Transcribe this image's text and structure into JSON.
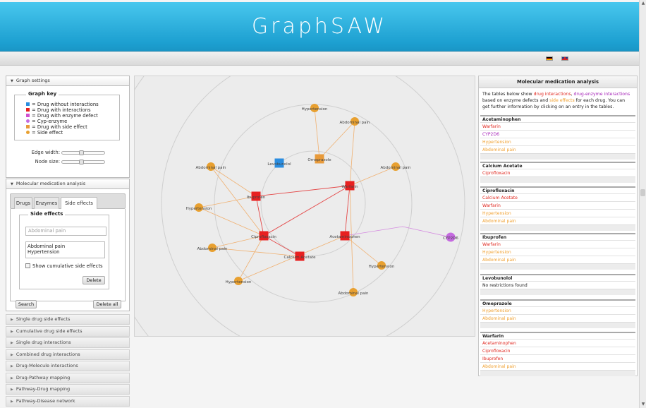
{
  "app": {
    "title": "GraphSAW",
    "languages": [
      {
        "name": "de-flag-icon"
      },
      {
        "name": "gb-flag-icon"
      }
    ]
  },
  "graph_settings": {
    "header": "Graph settings",
    "key_title": "Graph key",
    "key_items": [
      {
        "label": "= Drug without interactions",
        "color": "#2a8de0",
        "shape": "square"
      },
      {
        "label": "= Drug with interactions",
        "color": "#e82020",
        "shape": "square"
      },
      {
        "label": "= Drug with enzyme defect",
        "color": "#d050d0",
        "shape": "square"
      },
      {
        "label": "= Cyp-enzyme",
        "color": "#c56ae0",
        "shape": "circle"
      },
      {
        "label": "= Drug with side effect",
        "color": "#e89a3a",
        "shape": "square"
      },
      {
        "label": "= Side effect",
        "color": "#e8a030",
        "shape": "circle"
      }
    ],
    "edge_width_label": "Edge width:",
    "node_size_label": "Node size:",
    "edge_width_value": 0.45,
    "node_size_value": 0.45
  },
  "mma_panel": {
    "header": "Molecular medication analysis",
    "tabs": [
      {
        "label": "Drugs",
        "active": false
      },
      {
        "label": "Enzymes",
        "active": false
      },
      {
        "label": "Side effects",
        "active": true
      }
    ],
    "side_effects_title": "Side effects",
    "input_placeholder": "Abdominal pain",
    "list_items": [
      "Abdominal pain",
      "Hypertension"
    ],
    "cumulative_label": "Show cumulative side effects",
    "delete_label": "Delete",
    "search_label": "Search",
    "delete_all_label": "Delete all"
  },
  "accordion": [
    "Single drug side effects",
    "Cumulative drug side effects",
    "Single drug interactions",
    "Combined drug interactions",
    "Drug-Molecule interactions",
    "Drug-Pathway mapping",
    "Pathway-Drug mapping",
    "Pathway-Disease network"
  ],
  "graph": {
    "colors": {
      "interaction": "#e82020",
      "no_interaction": "#2a8de0",
      "side_effect_drug": "#e89a3a",
      "side_effect": "#e8a030",
      "enzyme": "#c56ae0",
      "edge_interaction": "#e44848",
      "edge_side_effect": "#f0b070",
      "edge_enzyme": "#d48ae0"
    },
    "nodes": {
      "drugs": [
        {
          "label": "Levobunolol",
          "color": "no_interaction"
        },
        {
          "label": "Omeprazole",
          "color": "side_effect_drug"
        },
        {
          "label": "Ibuprofen",
          "color": "interaction"
        },
        {
          "label": "Warfarin",
          "color": "interaction"
        },
        {
          "label": "Ciprofloxacin",
          "color": "interaction"
        },
        {
          "label": "Acetaminophen",
          "color": "interaction"
        },
        {
          "label": "Calcium Acetate",
          "color": "interaction"
        }
      ],
      "side_effects": [
        {
          "label": "Hypertension"
        },
        {
          "label": "Abdominal pain"
        },
        {
          "label": "Abdominal pain"
        },
        {
          "label": "Abdominal pain"
        },
        {
          "label": "Hypertension"
        },
        {
          "label": "Abdominal pain"
        },
        {
          "label": "Hypertension"
        },
        {
          "label": "Hypertension"
        },
        {
          "label": "Abdominal pain"
        }
      ],
      "enzymes": [
        {
          "label": "CYP2D6"
        }
      ]
    }
  },
  "results": {
    "title": "Molecular medication analysis",
    "intro_parts": [
      {
        "text": "The tables below show ",
        "cls": "c-none"
      },
      {
        "text": "drug interactions",
        "cls": "c-int"
      },
      {
        "text": ", ",
        "cls": "c-none"
      },
      {
        "text": "drug-enzyme interactions",
        "cls": "c-enz"
      },
      {
        "text": " based on enzyme defects and ",
        "cls": "c-none"
      },
      {
        "text": "side effects",
        "cls": "c-se"
      },
      {
        "text": " for each drug. You can get further information by clicking on an entry in the tables.",
        "cls": "c-none"
      }
    ],
    "drugs": [
      {
        "name": "Acetaminophen",
        "rows": [
          {
            "text": "Warfarin",
            "cls": "c-int"
          },
          {
            "text": "CYP2D6",
            "cls": "c-enz"
          },
          {
            "text": "Hypertension",
            "cls": "c-se"
          },
          {
            "text": "Abdominal pain",
            "cls": "c-se"
          }
        ]
      },
      {
        "name": "Calcium Acetate",
        "rows": [
          {
            "text": "Ciprofloxacin",
            "cls": "c-int"
          }
        ]
      },
      {
        "name": "Ciprofloxacin",
        "rows": [
          {
            "text": "Calcium Acetate",
            "cls": "c-int"
          },
          {
            "text": "Warfarin",
            "cls": "c-int"
          },
          {
            "text": "Hypertension",
            "cls": "c-se"
          },
          {
            "text": "Abdominal pain",
            "cls": "c-se"
          }
        ]
      },
      {
        "name": "Ibuprofen",
        "rows": [
          {
            "text": "Warfarin",
            "cls": "c-int"
          },
          {
            "text": "Hypertension",
            "cls": "c-se"
          },
          {
            "text": "Abdominal pain",
            "cls": "c-se"
          }
        ]
      },
      {
        "name": "Levobunolol",
        "rows": [
          {
            "text": "No restrictions found",
            "cls": "c-none"
          }
        ]
      },
      {
        "name": "Omeprazole",
        "rows": [
          {
            "text": "Hypertension",
            "cls": "c-se"
          },
          {
            "text": "Abdominal pain",
            "cls": "c-se"
          }
        ]
      },
      {
        "name": "Warfarin",
        "rows": [
          {
            "text": "Acetaminophen",
            "cls": "c-int"
          },
          {
            "text": "Ciprofloxacin",
            "cls": "c-int"
          },
          {
            "text": "Ibuprofen",
            "cls": "c-int"
          },
          {
            "text": "Abdominal pain",
            "cls": "c-se"
          }
        ]
      }
    ]
  }
}
